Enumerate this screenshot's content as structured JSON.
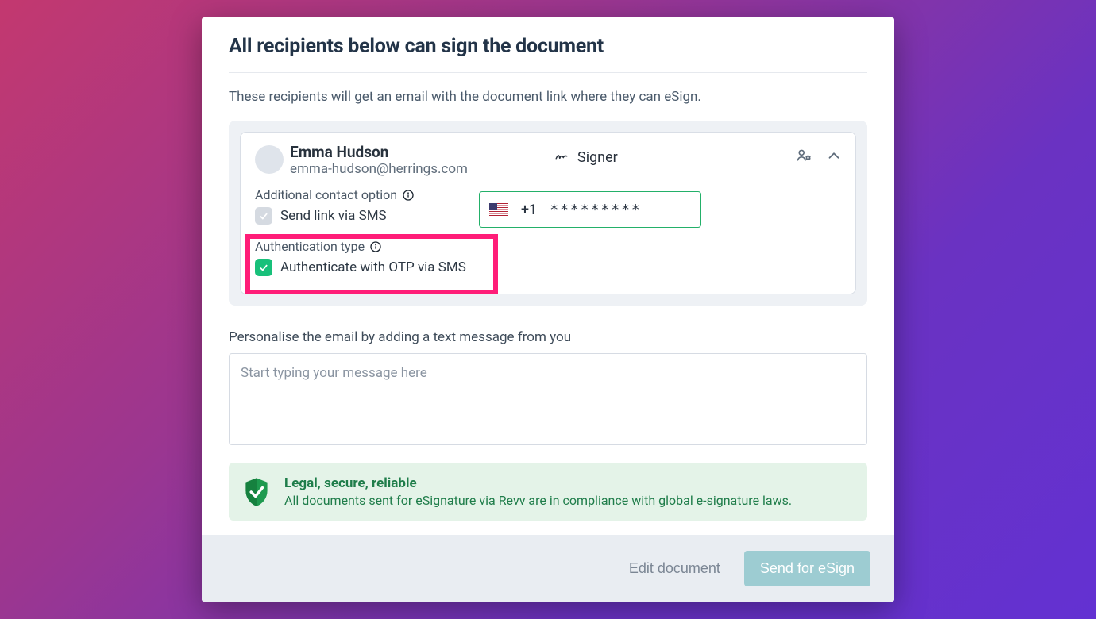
{
  "title": "All recipients below can sign the document",
  "subtitle": "These recipients will get an email with the document link where they can eSign.",
  "recipient": {
    "name": "Emma Hudson",
    "email": "emma-hudson@herrings.com",
    "role": "Signer"
  },
  "options": {
    "additional_contact_label": "Additional contact option",
    "send_link_sms_label": "Send link via SMS",
    "auth_label": "Authentication type",
    "auth_option_label": "Authenticate with OTP via SMS"
  },
  "phone": {
    "country_prefix": "+1",
    "masked_number": "*********"
  },
  "personalise_label": "Personalise the email by adding a text message from you",
  "message_placeholder": "Start typing your message here",
  "banner": {
    "title": "Legal, secure, reliable",
    "text": "All documents sent for eSignature via Revv are in compliance with global e-signature laws."
  },
  "footer": {
    "edit_label": "Edit document",
    "send_label": "Send for eSign"
  }
}
